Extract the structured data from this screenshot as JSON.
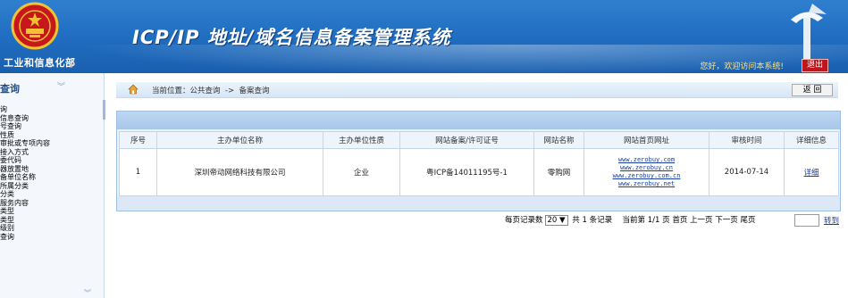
{
  "header": {
    "ministry_name": "工业和信息化部",
    "system_title": "ICP/IP 地址/域名信息备案管理系统",
    "welcome_text": "您好，欢迎访问本系统!",
    "logout_label": "退出"
  },
  "sidebar": {
    "title": "查询",
    "items": [
      "询",
      "信息查询",
      "号查询",
      "性质",
      "审批或专项内容",
      "接入方式",
      "委代码",
      "器放置地",
      "备单位名称",
      "所属分类",
      "分类",
      "服务内容",
      "类型",
      "类型",
      "级别",
      "查询"
    ]
  },
  "breadcrumb": {
    "text": "当前位置：公共查询  ->  备案查询",
    "back_label": "返 回"
  },
  "table": {
    "headers": [
      "序号",
      "主办单位名称",
      "主办单位性质",
      "网站备案/许可证号",
      "网站名称",
      "网站首页网址",
      "审核时间",
      "详细信息"
    ],
    "rows": [
      {
        "index": "1",
        "org_name": "深圳帝动网络科技有限公司",
        "org_type": "企业",
        "license": "粤ICP备14011195号-1",
        "site_name": "零购网",
        "urls": [
          "www.zerobuy.com",
          "www.zerobuy.cn",
          "www.zerobuy.com.cn",
          "www.zerobuy.net"
        ],
        "review_date": "2014-07-14",
        "detail_link": "详细"
      }
    ]
  },
  "pager": {
    "per_page_label": "每页记录数",
    "per_page_value": "20",
    "total_text": "共 1 条记录",
    "current_text": "当前第 1/1 页",
    "first": "首页",
    "prev": "上一页",
    "next": "下一页",
    "last": "尾页",
    "goto_label": "转到"
  },
  "colors": {
    "header_blue": "#1f6cc0",
    "logout_red": "#c0161b",
    "link_blue": "#1a3fa0"
  }
}
